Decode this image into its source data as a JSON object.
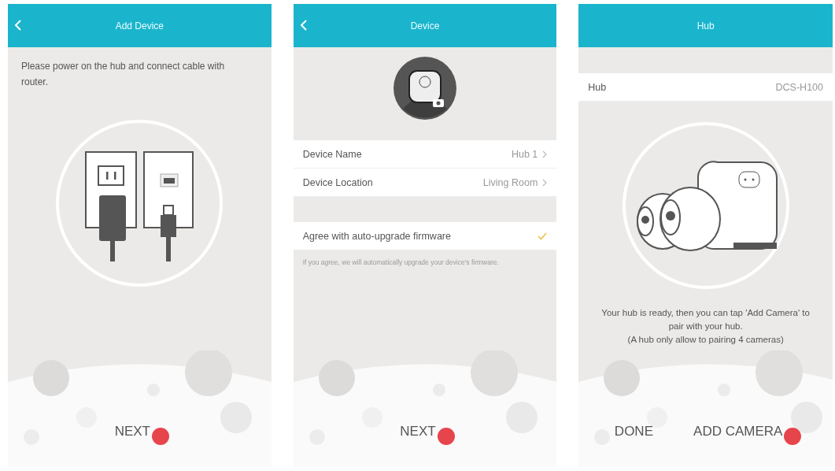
{
  "screens": [
    {
      "kind": "power",
      "title": "Add Device",
      "back": true,
      "instruction": "Please power on the hub and connect cable with router.",
      "buttons": [
        {
          "label": "NEXT",
          "tapped": true
        }
      ]
    },
    {
      "kind": "device",
      "title": "Device",
      "back": true,
      "rows": [
        {
          "label": "Device Name",
          "value": "Hub 1"
        },
        {
          "label": "Device Location",
          "value": "Living Room"
        }
      ],
      "firmware": {
        "label": "Agree with auto-upgrade firmware",
        "checked": true,
        "note": "If you agree, we will automatically upgrade your device's firmware."
      },
      "buttons": [
        {
          "label": "NEXT",
          "tapped": true
        }
      ]
    },
    {
      "kind": "ready",
      "title": "Hub",
      "back": false,
      "info": {
        "label": "Hub",
        "value": "DCS-H100"
      },
      "message": "Your hub is ready, then you can tap 'Add Camera' to pair with your hub.",
      "limit": "(A hub only allow to pairing 4 cameras)",
      "buttons": [
        {
          "label": "DONE",
          "tapped": false
        },
        {
          "label": "ADD CAMERA",
          "tapped": true
        }
      ]
    }
  ]
}
